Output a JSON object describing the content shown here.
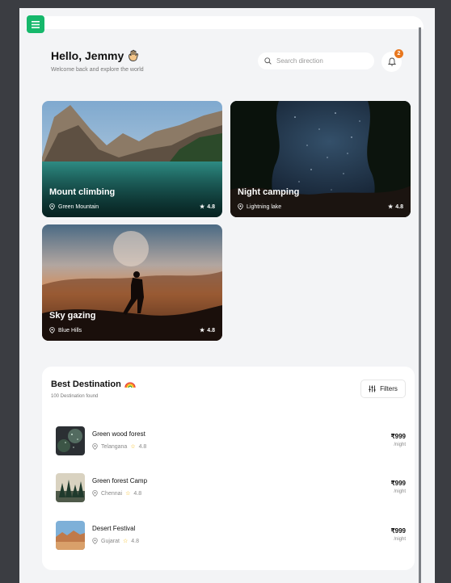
{
  "header": {
    "greeting": "Hello, Jemmy",
    "wave_icon": "waving-hand-icon",
    "subtitle": "Welcome back and explore the world",
    "search_placeholder": "Search direction",
    "notification_count": "2"
  },
  "featured": [
    {
      "title": "Mount climbing",
      "location": "Green Mountain",
      "rating": "4.8"
    },
    {
      "title": "Night camping",
      "location": "Lightning lake",
      "rating": "4.8"
    },
    {
      "title": "Sky gazing",
      "location": "Blue Hills",
      "rating": "4.8"
    }
  ],
  "best": {
    "title": "Best Destination",
    "title_icon": "rainbow-icon",
    "subtitle": "100 Destination found",
    "filters_label": "Filters",
    "items": [
      {
        "name": "Green wood forest",
        "location": "Telangana",
        "rating": "4.8",
        "price": "₹999",
        "per": "/night"
      },
      {
        "name": "Green forest Camp",
        "location": "Chennai",
        "rating": "4.8",
        "price": "₹999",
        "per": "/night"
      },
      {
        "name": "Desert Festival",
        "location": "Gujarat",
        "rating": "4.8",
        "price": "₹999",
        "per": "/night"
      }
    ]
  },
  "colors": {
    "accent": "#16b86b",
    "badge": "#e8771e",
    "star": "#f5b400"
  }
}
